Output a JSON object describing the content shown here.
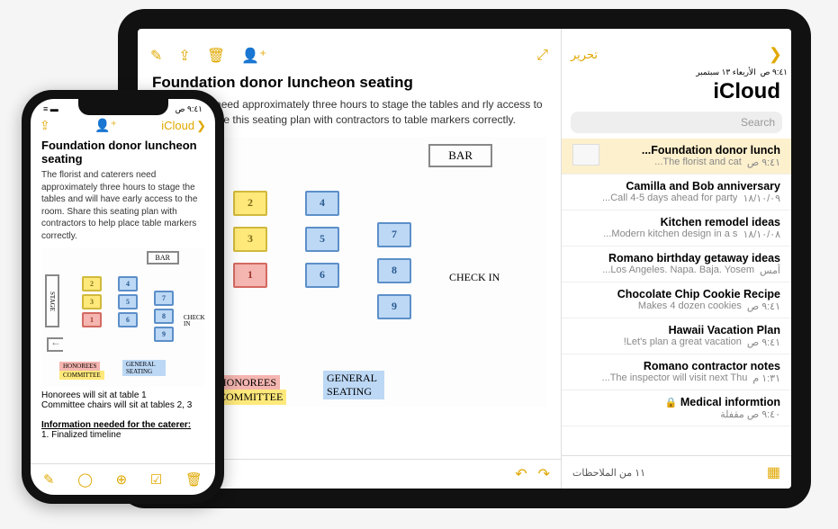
{
  "ipad": {
    "status": {
      "time": "٩:٤١ ص",
      "date": "الأربعاء ١٣ سبتمبر"
    },
    "sidebar": {
      "edit_label": "تحرير",
      "title": "iCloud",
      "search_placeholder": "Search",
      "footer_count": "١١ من الملاحظات",
      "notes": [
        {
          "title": "Foundation donor lunch...",
          "time": "٩:٤١ ص",
          "preview": "The florist and cat..."
        },
        {
          "title": "Camilla and Bob anniversary",
          "time": "١٨/١٠/٠٩",
          "preview": "Call 4-5 days ahead for party..."
        },
        {
          "title": "Kitchen remodel ideas",
          "time": "١٨/١٠/٠٨",
          "preview": "Modern kitchen design in a s..."
        },
        {
          "title": "Romano birthday getaway ideas",
          "time": "أمس",
          "preview": "Los Angeles. Napa. Baja. Yosem..."
        },
        {
          "title": "Chocolate Chip Cookie Recipe",
          "time": "٩:٤١ ص",
          "preview": "Makes 4 dozen cookies"
        },
        {
          "title": "Hawaii Vacation Plan",
          "time": "٩:٤١ ص",
          "preview": "Let's plan a great vacation!"
        },
        {
          "title": "Romano contractor notes",
          "time": "١:٣١ م",
          "preview": "The inspector will visit next Thu..."
        },
        {
          "title": "Medical informtion",
          "time": "",
          "preview": "٩:٤٠ ص مقفلة",
          "locked": true
        }
      ]
    },
    "note": {
      "title": "Foundation donor luncheon seating",
      "body": "and caterers need approximately three hours to stage the tables and rly access to the room. Share this seating plan with contractors to table markers correctly.",
      "sketch": {
        "bar": "BAR",
        "stage": "STAGE",
        "checkin": "CHECK IN",
        "tables": [
          "1",
          "2",
          "3",
          "4",
          "5",
          "6",
          "7",
          "8",
          "9"
        ],
        "legend_honorees": "HONOREES",
        "legend_committee": "COMMITTEE",
        "legend_general": "GENERAL SEATING"
      }
    }
  },
  "iphone": {
    "status_time": "٩:٤١ ص",
    "back_label": "iCloud",
    "note": {
      "title": "Foundation donor luncheon seating",
      "body": "The florist and caterers need approximately three hours to stage the tables and will have early access to the room. Share this seating plan with contractors to help place table markers correctly.",
      "line1": "Honorees will sit at table 1",
      "line2": "Committee chairs will sit at tables 2, 3",
      "info_header": "Information needed for the caterer:",
      "list1": "1.  Finalized timeline"
    }
  },
  "colors": {
    "accent": "#e0a800"
  }
}
